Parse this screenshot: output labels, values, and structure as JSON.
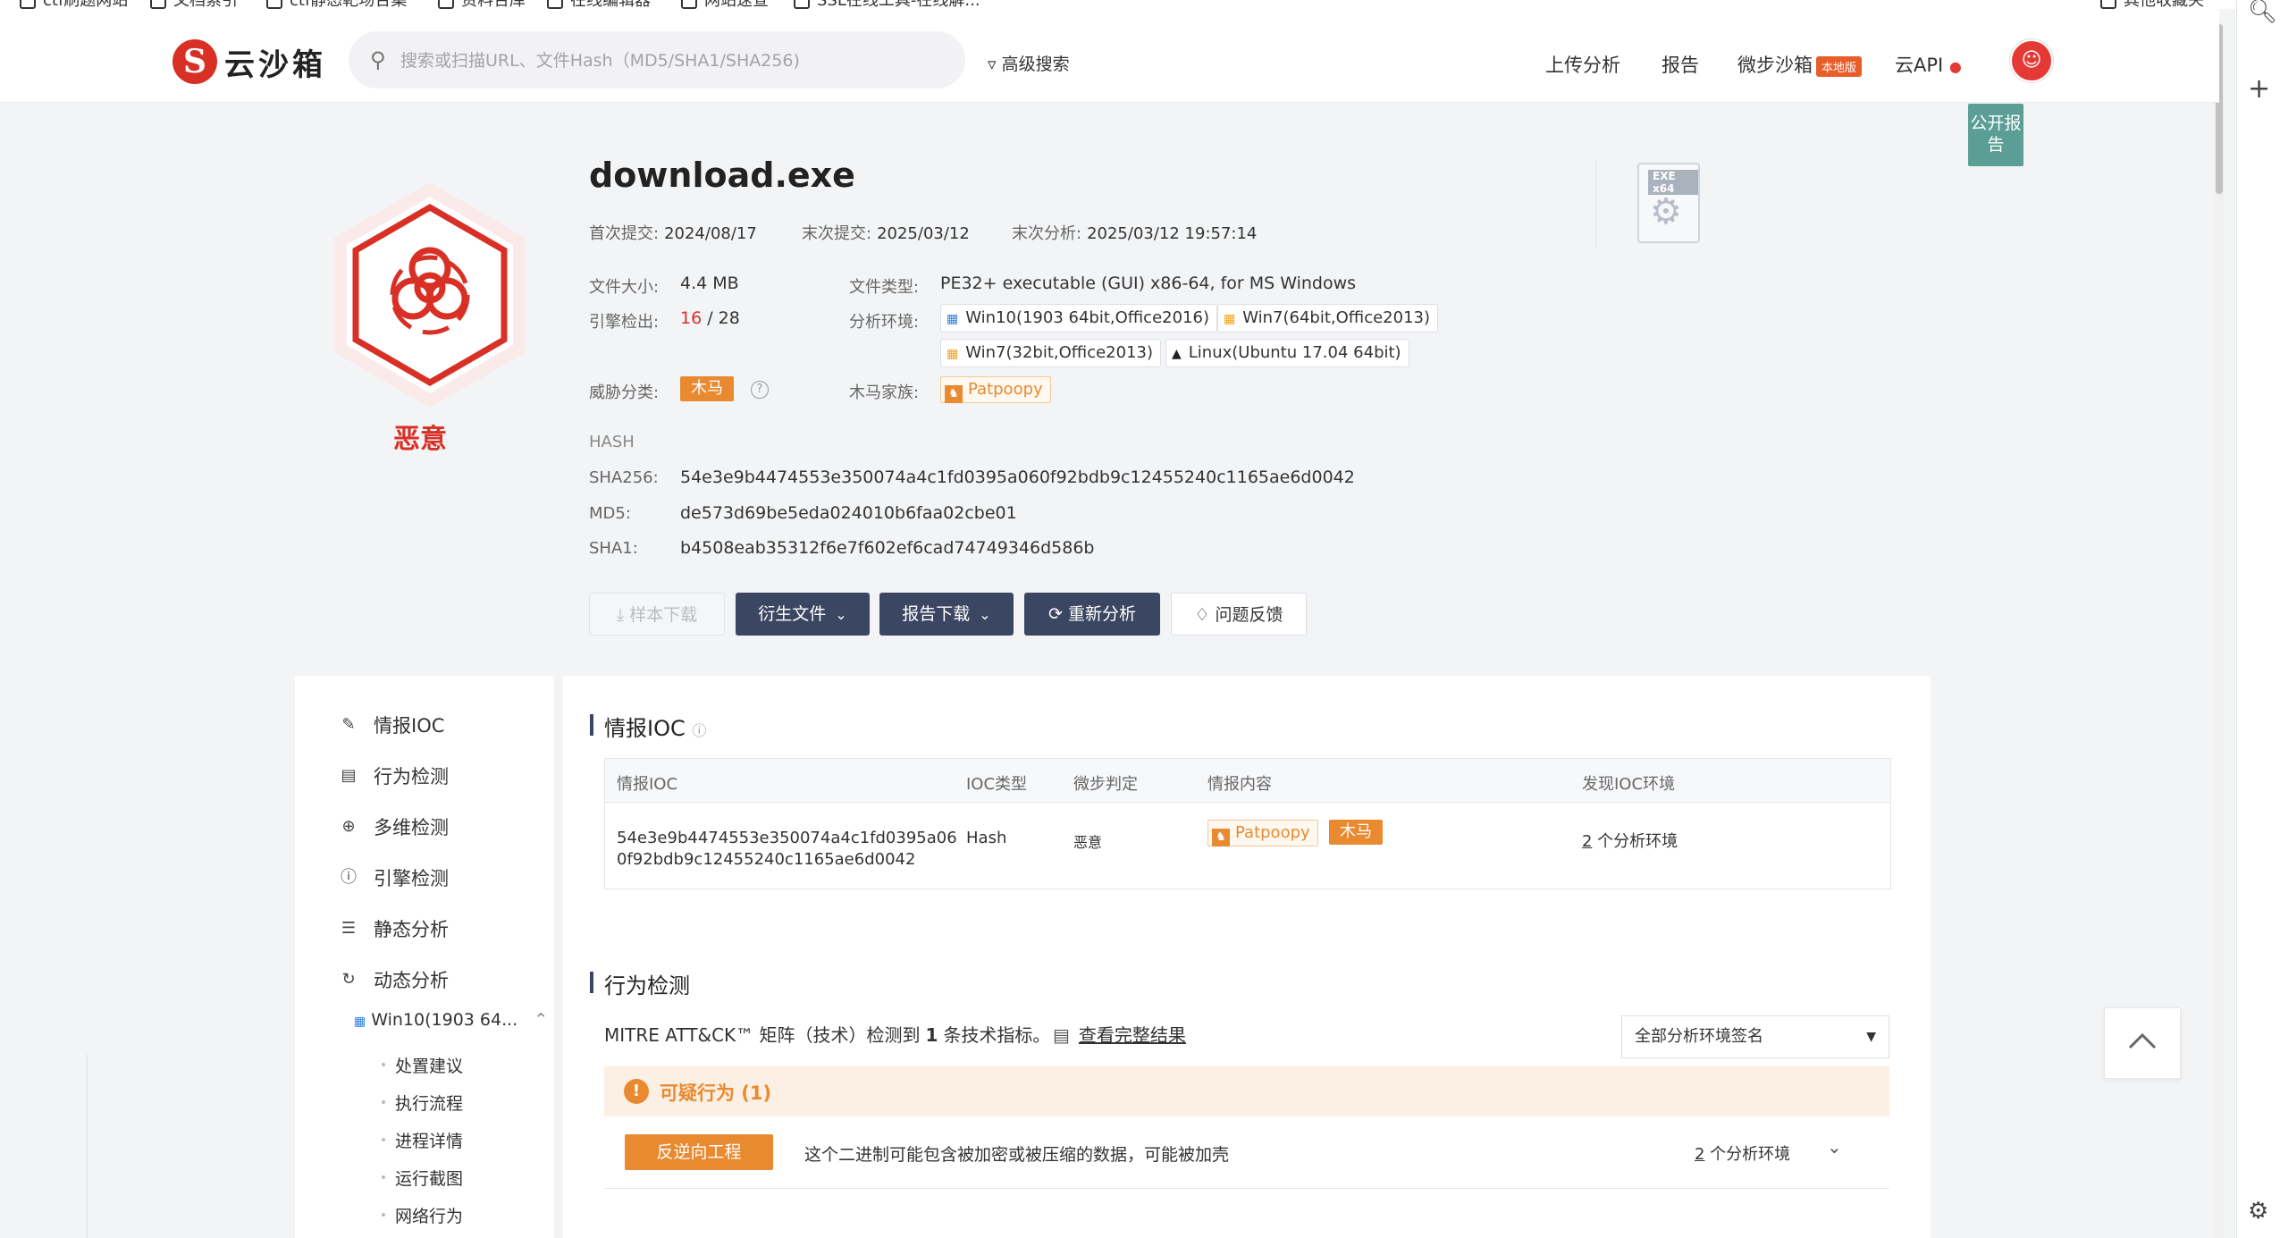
{
  "bookmarks": [
    "ctf刷题网站",
    "文档索引",
    "ctf静态靶场合集",
    "资料合库",
    "在线编辑器",
    "网站速查",
    "SSL在线工具-在线解...",
    "其他收藏夹"
  ],
  "header": {
    "logo_mark": "S",
    "logo_text": "云沙箱",
    "search_placeholder": "搜索或扫描URL、文件Hash（MD5/SHA1/SHA256)",
    "advanced_search": "高级搜索",
    "nav": {
      "upload": "上传分析",
      "report": "报告",
      "sandbox": "微步沙箱",
      "sandbox_badge": "本地版",
      "api": "云API"
    },
    "public_report": "公开报告"
  },
  "file": {
    "name": "download.exe",
    "verdict": "恶意",
    "first_submit_label": "首次提交:",
    "first_submit": "2024/08/17",
    "last_submit_label": "末次提交:",
    "last_submit": "2025/03/12",
    "last_analysis_label": "末次分析:",
    "last_analysis": "2025/03/12 19:57:14",
    "size_label": "文件大小:",
    "size": "4.4 MB",
    "engine_label": "引擎检出:",
    "engine_hits": "16",
    "engine_sep": " / ",
    "engine_total": "28",
    "threat_label": "威胁分类:",
    "threat": "木马",
    "type_label": "文件类型:",
    "type": "PE32+ executable (GUI) x86-64, for MS Windows",
    "env_label": "分析环境:",
    "envs": [
      "Win10(1903 64bit,Office2016)",
      "Win7(64bit,Office2013)",
      "Win7(32bit,Office2013)",
      "Linux(Ubuntu 17.04 64bit)"
    ],
    "family_label": "木马家族:",
    "family": "Patpoopy",
    "exe_tag": "EXE x64",
    "hash_title": "HASH",
    "sha256_label": "SHA256:",
    "sha256": "54e3e9b4474553e350074a4c1fd0395a060f92bdb9c12455240c1165ae6d0042",
    "md5_label": "MD5:",
    "md5": "de573d69be5eda024010b6faa02cbe01",
    "sha1_label": "SHA1:",
    "sha1": "b4508eab35312f6e7f602ef6cad74749346d586b"
  },
  "actions": {
    "sample_download": "样本下载",
    "derived_files": "衍生文件",
    "report_download": "报告下载",
    "reanalyze": "重新分析",
    "feedback": "问题反馈"
  },
  "sidebar": {
    "items": [
      "情报IOC",
      "行为检测",
      "多维检测",
      "引擎检测",
      "静态分析",
      "动态分析"
    ],
    "env_item": "Win10(1903 64...",
    "sub_items": [
      "处置建议",
      "执行流程",
      "进程详情",
      "运行截图",
      "网络行为"
    ]
  },
  "ioc": {
    "title": "情报IOC",
    "headers": [
      "情报IOC",
      "IOC类型",
      "微步判定",
      "情报内容",
      "发现IOC环境"
    ],
    "row": {
      "ioc_line1": "54e3e9b4474553e350074a4c1fd0395a06",
      "ioc_line2": "0f92bdb9c12455240c1165ae6d0042",
      "type": "Hash",
      "verdict": "恶意",
      "family": "Patpoopy",
      "tag": "木马",
      "env_count": "2",
      "env_text": " 个分析环境"
    }
  },
  "behavior": {
    "title": "行为检测",
    "mitre_prefix": "MITRE ATT&CK™ 矩阵（技术）检测到",
    "mitre_count": "1",
    "mitre_suffix": "条技术指标。",
    "view_full": "查看完整结果",
    "filter": "全部分析环境签名",
    "suspicious": "可疑行为 (1)",
    "item_tag": "反逆向工程",
    "item_desc": "这个二进制可能包含被加密或被压缩的数据，可能被加壳",
    "item_env_count": "2",
    "item_env_text": " 个分析环境"
  },
  "colors": {
    "malicious_red": "#d93026",
    "accent_orange": "#e98a31",
    "button_dark": "#3b4762",
    "public_report_teal": "#5b9e95"
  }
}
